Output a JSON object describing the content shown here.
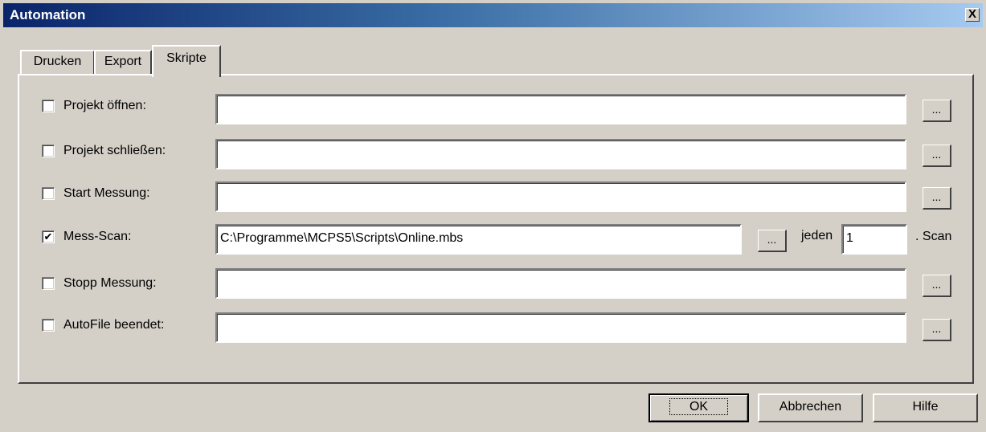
{
  "window": {
    "title": "Automation",
    "close_label": "X"
  },
  "tabs": [
    {
      "label": "Drucken",
      "selected": false
    },
    {
      "label": "Export",
      "selected": false
    },
    {
      "label": "Skripte",
      "selected": true
    }
  ],
  "scripts": [
    {
      "label": "Projekt öffnen:",
      "checked": false,
      "check_mark": "",
      "value": "",
      "browse_label": "..."
    },
    {
      "label": "Projekt schließen:",
      "checked": false,
      "check_mark": "",
      "value": "",
      "browse_label": "..."
    },
    {
      "label": "Start Messung:",
      "checked": false,
      "check_mark": "",
      "value": "",
      "browse_label": "..."
    },
    {
      "label": "Mess-Scan:",
      "checked": true,
      "check_mark": "✔",
      "value": "C:\\Programme\\MCPS5\\Scripts\\Online.mbs",
      "browse_label": "...",
      "every_label": "jeden",
      "every_value": "1",
      "every_suffix": ". Scan"
    },
    {
      "label": "Stopp Messung:",
      "checked": false,
      "check_mark": "",
      "value": "",
      "browse_label": "..."
    },
    {
      "label": "AutoFile beendet:",
      "checked": false,
      "check_mark": "",
      "value": "",
      "browse_label": "..."
    }
  ],
  "buttons": {
    "ok": "OK",
    "cancel": "Abbrechen",
    "help": "Hilfe"
  }
}
